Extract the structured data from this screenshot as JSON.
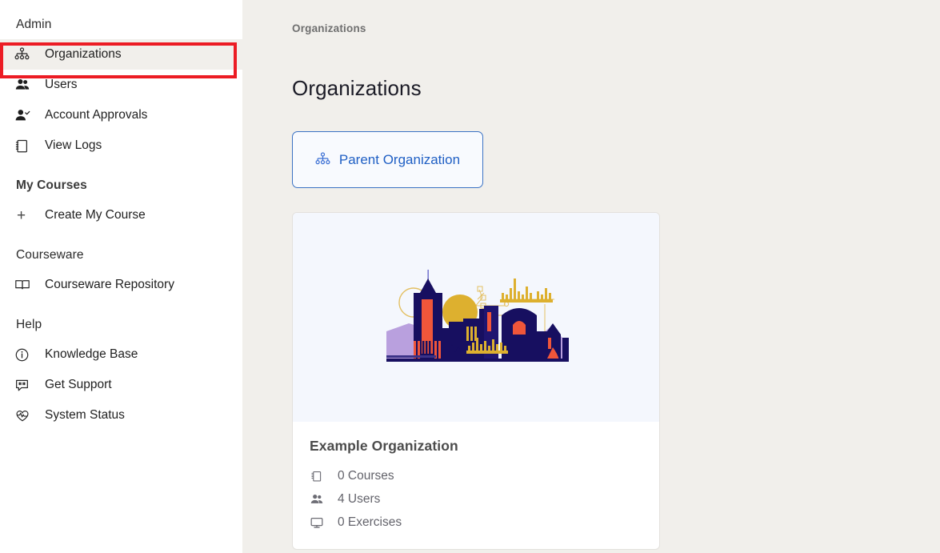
{
  "sidebar": {
    "sections": [
      {
        "title": "Admin",
        "title_bold": false,
        "items": [
          {
            "label": "Organizations",
            "icon": "hierarchy-icon",
            "active": true
          },
          {
            "label": "Users",
            "icon": "users-icon",
            "active": false
          },
          {
            "label": "Account Approvals",
            "icon": "user-check-icon",
            "active": false
          },
          {
            "label": "View Logs",
            "icon": "notepad-icon",
            "active": false
          }
        ]
      },
      {
        "title": "My Courses",
        "title_bold": true,
        "items": [
          {
            "label": "Create My Course",
            "icon": "plus-icon",
            "active": false
          }
        ]
      },
      {
        "title": "Courseware",
        "title_bold": false,
        "items": [
          {
            "label": "Courseware Repository",
            "icon": "book-icon",
            "active": false
          }
        ]
      },
      {
        "title": "Help",
        "title_bold": false,
        "items": [
          {
            "label": "Knowledge Base",
            "icon": "info-circle-icon",
            "active": false
          },
          {
            "label": "Get Support",
            "icon": "chat-quote-icon",
            "active": false
          },
          {
            "label": "System Status",
            "icon": "heartbeat-shield-icon",
            "active": false
          }
        ]
      }
    ]
  },
  "main": {
    "breadcrumb": "Organizations",
    "page_title": "Organizations",
    "parent_org_button": {
      "label": "Parent Organization",
      "icon": "hierarchy-icon"
    },
    "card": {
      "illustration": "city-skyline-illustration",
      "title": "Example Organization",
      "stats": [
        {
          "label": "0 Courses",
          "icon": "courses-icon"
        },
        {
          "label": "4 Users",
          "icon": "users-icon"
        },
        {
          "label": "0 Exercises",
          "icon": "monitor-icon"
        }
      ]
    }
  },
  "annotation": {
    "target": "Organizations",
    "color": "#ec1c24"
  },
  "colors": {
    "page_background": "#f1efeb",
    "sidebar_background": "#ffffff",
    "accent_blue": "#1f5fc4",
    "illustration_background": "#f4f7fd",
    "illustration_navy": "#170f60",
    "illustration_purple": "#b39ddb",
    "illustration_gold": "#e0b02e",
    "illustration_orange": "#f0563a",
    "annotation_red": "#ec1c24"
  }
}
